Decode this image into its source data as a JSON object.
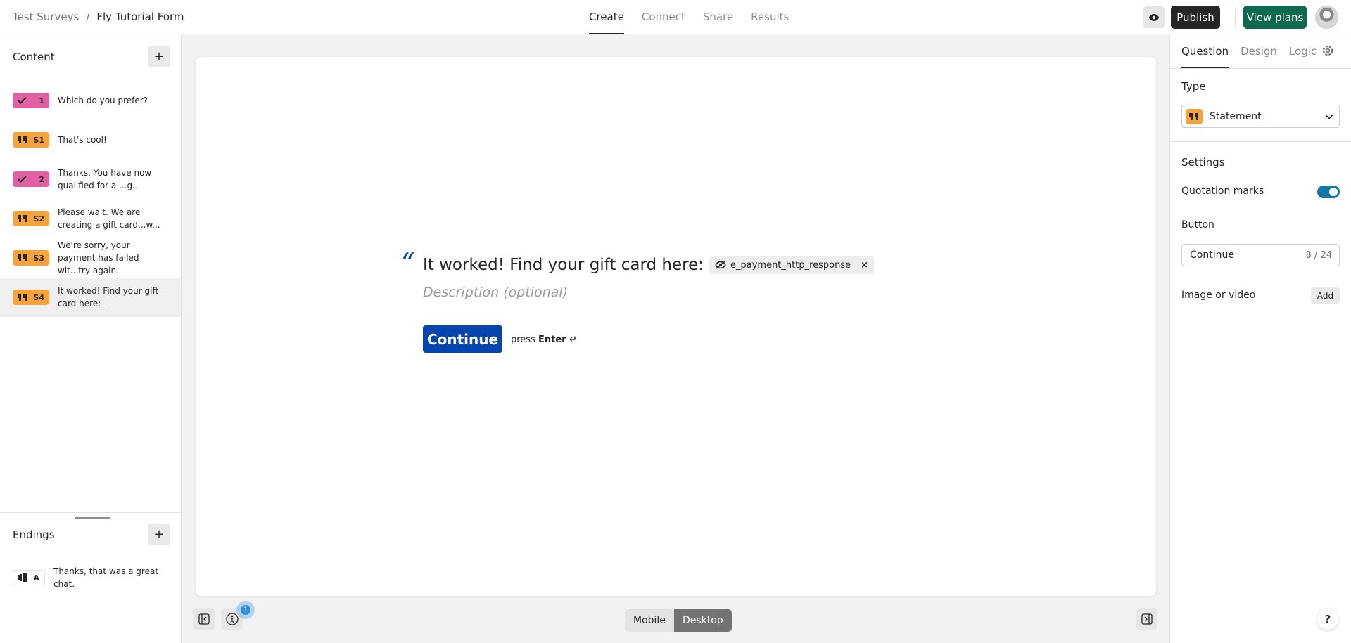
{
  "header": {
    "breadcrumb_root": "Test Surveys",
    "breadcrumb_sep": "/",
    "form_title": "Fly Tutorial Form",
    "tabs": [
      {
        "label": "Create",
        "active": true
      },
      {
        "label": "Connect",
        "active": false
      },
      {
        "label": "Share",
        "active": false
      },
      {
        "label": "Results",
        "active": false
      }
    ],
    "publish_label": "Publish",
    "view_plans_label": "View plans",
    "colors": {
      "publish": "#262627",
      "view_plans": "#0c6b4f"
    }
  },
  "left_panel": {
    "content_title": "Content",
    "add_label": "+",
    "questions": [
      {
        "badge_icon": "checkmark-icon",
        "badge_text": "1",
        "color": "#e060a2",
        "text": "Which do you prefer?"
      },
      {
        "badge_icon": "quote-icon",
        "badge_text": "S1",
        "color": "#f6a33c",
        "text": "That's cool!"
      },
      {
        "badge_icon": "checkmark-icon",
        "badge_text": "2",
        "color": "#e060a2",
        "text": "Thanks. You have now qualified for a ...g..."
      },
      {
        "badge_icon": "quote-icon",
        "badge_text": "S2",
        "color": "#f6a33c",
        "text": "Please wait. We are creating a gift card...w..."
      },
      {
        "badge_icon": "quote-icon",
        "badge_text": "S3",
        "color": "#f6a33c",
        "text": "We're sorry, your payment has failed wit...try again."
      },
      {
        "badge_icon": "quote-icon",
        "badge_text": "S4",
        "color": "#f6a33c",
        "text": "It worked! Find your gift card here: _",
        "selected": true
      }
    ],
    "endings_title": "Endings",
    "endings": [
      {
        "badge_icon": "ending-icon",
        "badge_text": "A",
        "text": "Thanks, that was a great chat."
      }
    ]
  },
  "canvas": {
    "quote_mark": "“",
    "title": "It worked! Find your gift card here:",
    "variable_chip": "e_payment_http_response",
    "chip_remove": "×",
    "description_placeholder": "Description (optional)",
    "continue_label": "Continue",
    "press_text": "press",
    "enter_text": "Enter ↵",
    "accent_color": "#0445af"
  },
  "bottom_bar": {
    "notification_count": "1",
    "device_modes": [
      "Mobile",
      "Desktop"
    ],
    "active_device": "Desktop"
  },
  "right_panel": {
    "tabs": [
      {
        "label": "Question",
        "active": true
      },
      {
        "label": "Design",
        "active": false
      },
      {
        "label": "Logic",
        "active": false
      }
    ],
    "type_label": "Type",
    "type_value": "Statement",
    "settings_label": "Settings",
    "quotation_marks_label": "Quotation marks",
    "quotation_marks_on": true,
    "button_label": "Button",
    "button_value": "Continue",
    "button_count": "8 / 24",
    "image_video_label": "Image or video",
    "add_media_label": "Add",
    "help_label": "?"
  }
}
